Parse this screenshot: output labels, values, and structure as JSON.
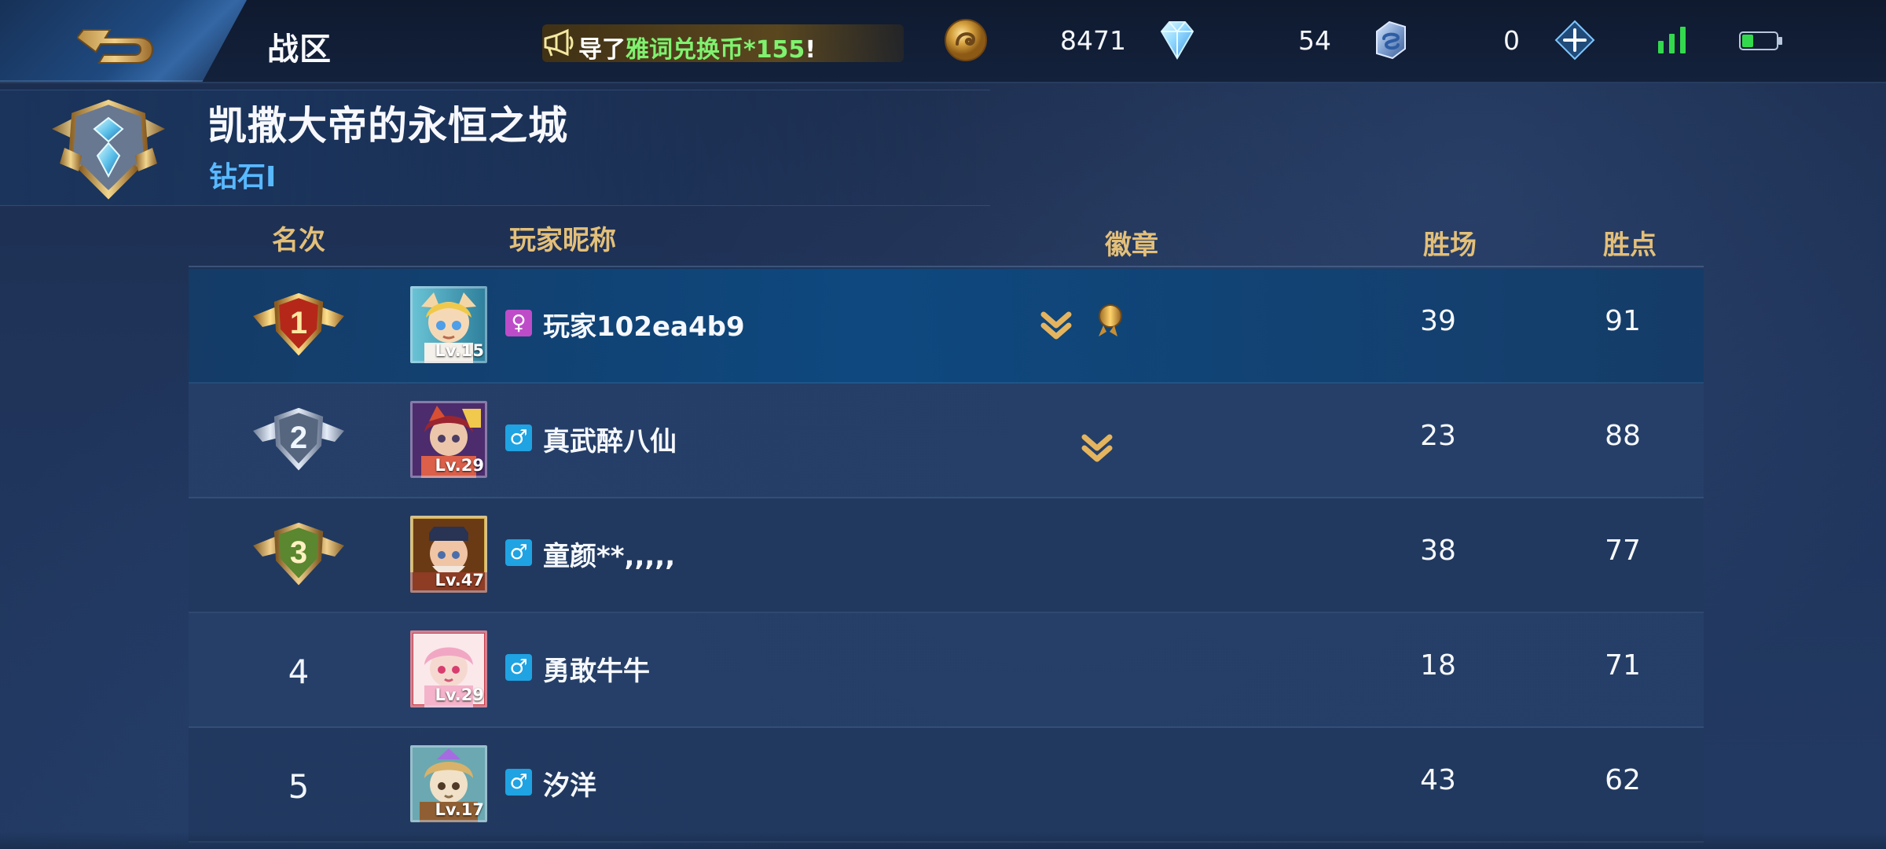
{
  "header": {
    "tab_label": "战区",
    "notice_prefix": "导了",
    "notice_highlight": "雅词兑换币*155",
    "notice_suffix": "!",
    "coin_value": "8471",
    "diamond_value": "54",
    "star_value": "0"
  },
  "zone": {
    "title": "凯撒大帝的永恒之城",
    "tier": "钻石I"
  },
  "table": {
    "headers": {
      "rank": "名次",
      "player": "玩家昵称",
      "badges": "徽章",
      "wins": "胜场",
      "points": "胜点"
    },
    "rows": [
      {
        "rank": "1",
        "level": "Lv.15",
        "gender": "♀",
        "name": "玩家102ea4b9",
        "wins": "39",
        "points": "91"
      },
      {
        "rank": "2",
        "level": "Lv.29",
        "gender": "♂",
        "name": "真武醉八仙",
        "wins": "23",
        "points": "88"
      },
      {
        "rank": "3",
        "level": "Lv.47",
        "gender": "♂",
        "name": "童颜**,,,,,",
        "wins": "38",
        "points": "77"
      },
      {
        "rank": "4",
        "level": "Lv.29",
        "gender": "♂",
        "name": "勇敢牛牛",
        "wins": "18",
        "points": "71"
      },
      {
        "rank": "5",
        "level": "Lv.17",
        "gender": "♂",
        "name": "汐洋",
        "wins": "43",
        "points": "62"
      }
    ]
  },
  "icons": {
    "back": "back-arrow-icon",
    "notice": "megaphone-icon",
    "coin": "gold-coin-icon",
    "diamond": "diamond-icon",
    "star": "star-token-icon",
    "add": "plus-icon",
    "signal": "signal-icon",
    "battery": "battery-icon"
  },
  "colors": {
    "accent_gold": "#e3bf79",
    "accent_blue": "#59b9ff",
    "signal_green": "#33d94d",
    "gender_female": "#be4cc9",
    "gender_male": "#1fa3e2"
  }
}
